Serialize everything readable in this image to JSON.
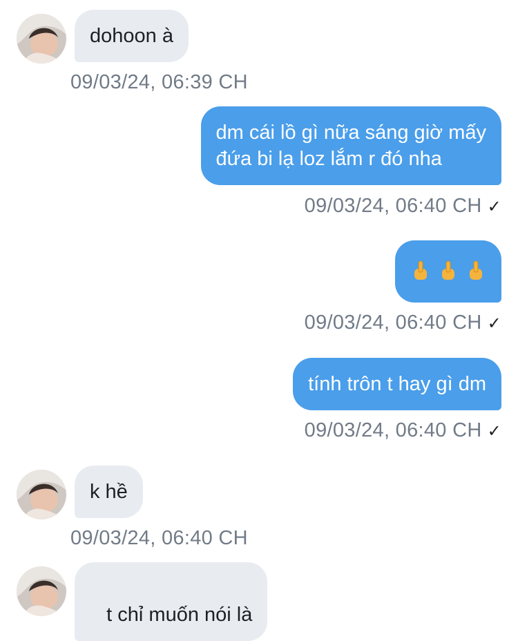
{
  "messages": [
    {
      "side": "in",
      "text": "dohoon à",
      "time": "09/03/24, 06:39 CH"
    },
    {
      "side": "out",
      "lines": [
        "dm cái lồ gì nữa sáng giờ mấy",
        "đứa bi lạ loz lắm r đó nha"
      ],
      "time": "09/03/24, 06:40 CH",
      "status_icon": "checkmark-icon"
    },
    {
      "side": "out",
      "emoji": "middle-finger-emoji",
      "emoji_count": 3,
      "time": "09/03/24, 06:40 CH",
      "status_icon": "checkmark-icon"
    },
    {
      "side": "out",
      "text": "tính trôn t hay gì dm",
      "time": "09/03/24, 06:40 CH",
      "status_icon": "checkmark-icon"
    },
    {
      "side": "in",
      "text": "k hề",
      "time": "09/03/24, 06:40 CH"
    },
    {
      "side": "in",
      "text": " t chỉ muốn nói là"
    }
  ],
  "check_glyph": "✓",
  "colors": {
    "outgoing_bubble": "#4a9eea",
    "incoming_bubble": "#e8ecf0",
    "timestamp": "#717b87"
  }
}
